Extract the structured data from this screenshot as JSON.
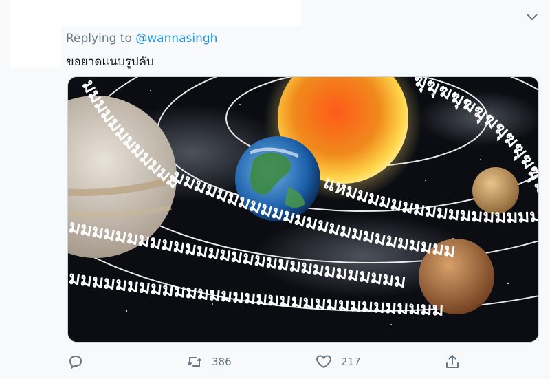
{
  "reply": {
    "prefix": "Replying to",
    "handle": "@wannasingh"
  },
  "tweet": {
    "text": "ขอยาดแนบรูปคับ"
  },
  "image": {
    "subject": "solar-system-planets",
    "overlay_text": {
      "top_right_arc": "ฆุฆุฆฆุฆฆุฆฆุฆฆุฆฆุฆฆุฆฆุฆ",
      "mid_row": "แหมมมมมมมมมมมมมมมมมมมมมมม",
      "low_row": "มมมมมมมมมมมมมมมมมมมมมมมมม",
      "lower_row": "มมมมมมมมมมมมมมมมมมมมมมมมมมมมม",
      "bottom_row": "มมมมมมมมมมมมมมมมมมมมมมมมมมมมมมมม",
      "left_arc": "มมมมมมมมมมมมมมมมมมมม"
    }
  },
  "actions": {
    "reply_count": "",
    "retweet_count": "386",
    "like_count": "217"
  },
  "colors": {
    "accent": "#1b95e0",
    "secondary_text": "#657786",
    "sun": "#f5a623",
    "space": "#0b0d12"
  },
  "icons": {
    "reply": "reply-icon",
    "retweet": "retweet-icon",
    "like": "heart-icon",
    "share": "share-icon",
    "menu": "chevron-down-icon"
  }
}
